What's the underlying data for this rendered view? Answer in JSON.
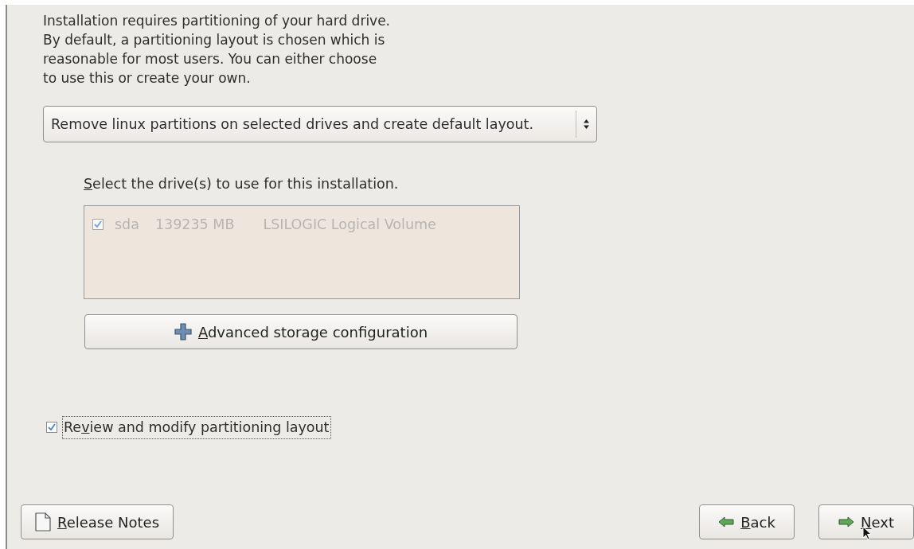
{
  "intro": "Installation requires partitioning of your hard drive.\nBy default, a partitioning layout is chosen which is\nreasonable for most users.  You can either choose\nto use this or create your own.",
  "layout_dropdown": {
    "value": "Remove linux partitions on selected drives and create default layout."
  },
  "drives": {
    "label": {
      "underlined": "S",
      "rest": "elect the drive(s) to use for this installation."
    },
    "disabled": true,
    "rows": [
      {
        "checked": true,
        "name": "sda",
        "size": "139235 MB",
        "model": "LSILOGIC Logical Volume"
      }
    ]
  },
  "advanced_button": {
    "label": {
      "underlined": "A",
      "rest": "dvanced storage configuration"
    }
  },
  "review_checkbox": {
    "label": {
      "start": "Re",
      "underlined": "v",
      "rest": "iew and modify partitioning layout"
    },
    "checked": true
  },
  "buttons": [
    {
      "kind": "notes",
      "label": {
        "underlined": "R",
        "rest": "elease Notes"
      }
    },
    {
      "kind": "back",
      "label": {
        "underlined": "B",
        "rest": "ack"
      }
    },
    {
      "kind": "next",
      "label": {
        "underlined": "N",
        "rest": "ext"
      }
    }
  ]
}
